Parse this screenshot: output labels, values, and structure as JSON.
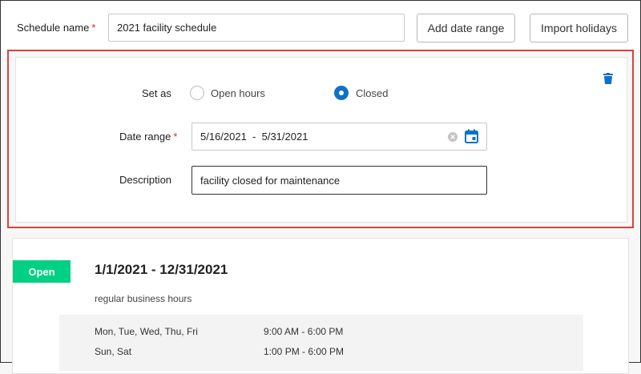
{
  "header": {
    "schedule_name_label": "Schedule name",
    "required_mark": "*",
    "schedule_name_value": "2021 facility schedule",
    "add_date_range_label": "Add date range",
    "import_holidays_label": "Import holidays"
  },
  "editor": {
    "set_as_label": "Set as",
    "option_open": "Open hours",
    "option_closed": "Closed",
    "selected": "Closed",
    "date_range_label": "Date range",
    "date_range_value": "5/16/2021  -  5/31/2021",
    "description_label": "Description",
    "description_value": "facility closed for maintenance"
  },
  "schedule_card": {
    "status": "Open",
    "range": "1/1/2021 - 12/31/2021",
    "description": "regular business hours",
    "rows": [
      {
        "days": "Mon, Tue, Wed, Thu, Fri",
        "hours": "9:00 AM - 6:00 PM"
      },
      {
        "days": "Sun, Sat",
        "hours": "1:00 PM - 6:00 PM"
      }
    ]
  },
  "colors": {
    "accent": "#0e71c8",
    "open_badge": "#00d084",
    "highlight_frame": "#d9423b"
  }
}
